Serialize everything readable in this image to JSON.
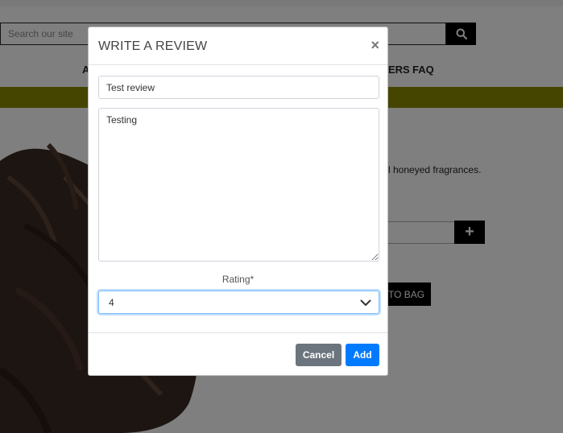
{
  "background": {
    "search": {
      "placeholder": "Search our site"
    },
    "nav": {
      "partial_left": "A",
      "partial_right": "ERS",
      "faq": "FAQ"
    },
    "product": {
      "description_tail": "l honeyed fragrances.",
      "qty_plus": "+",
      "add_to_bag_partial": "TO BAG"
    },
    "colors": {
      "banner": "#8a8a00",
      "overlay": "rgba(0,0,0,0.5)"
    }
  },
  "modal": {
    "title": "WRITE A REVIEW",
    "close_symbol": "×",
    "review_title_value": "Test review",
    "review_text_value": "Testing",
    "rating_label": "Rating*",
    "rating_value": "4",
    "cancel_label": "Cancel",
    "add_label": "Add",
    "colors": {
      "add": "#007bff",
      "cancel": "#6c757d"
    }
  },
  "icons": {
    "search": "search-icon",
    "close": "close-icon",
    "chevron": "chevron-down-icon",
    "plus": "plus-icon"
  }
}
